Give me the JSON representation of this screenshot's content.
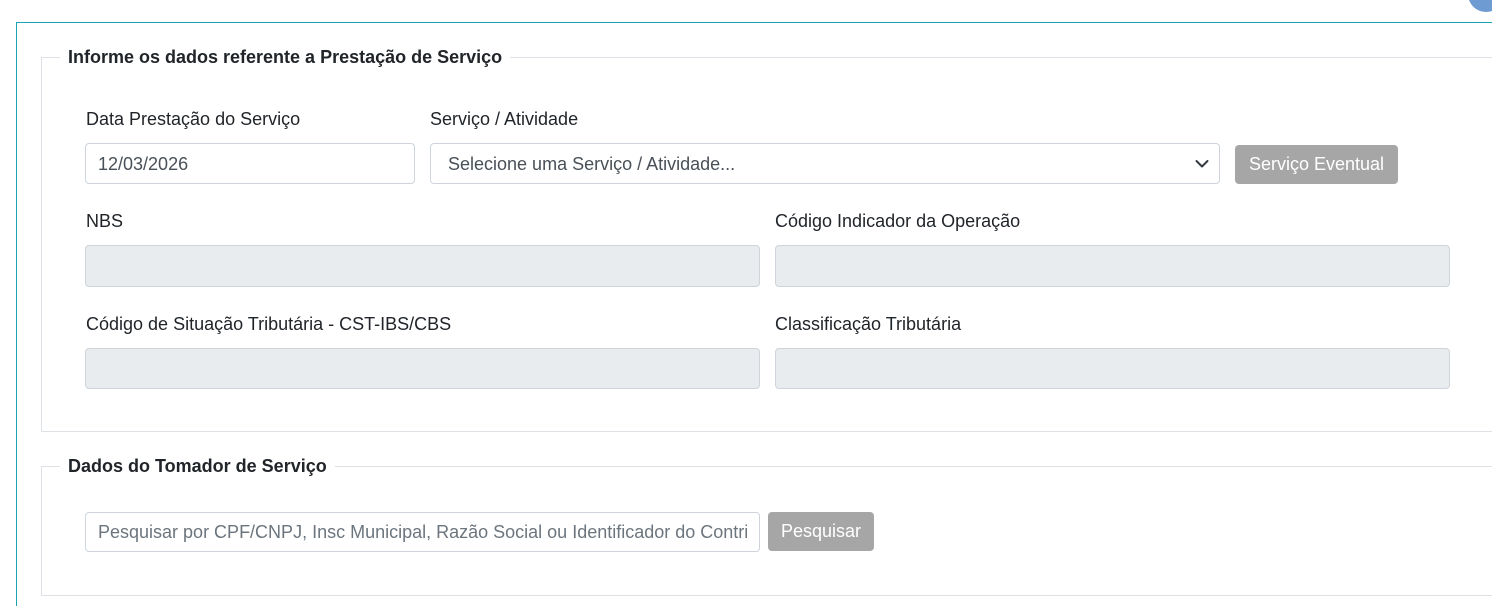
{
  "prestacao": {
    "legend": "Informe os dados referente a Prestação de Serviço",
    "data_label": "Data Prestação do Serviço",
    "data_value": "12/03/2026",
    "servico_label": "Serviço / Atividade",
    "servico_selected": "Selecione uma Serviço / Atividade...",
    "eventual_button": "Serviço Eventual",
    "nbs_label": "NBS",
    "nbs_value": "",
    "indicador_label": "Código Indicador da Operação",
    "indicador_value": "",
    "cst_label": "Código de Situação Tributária - CST-IBS/CBS",
    "cst_value": "",
    "classificacao_label": "Classificação Tributária",
    "classificacao_value": ""
  },
  "tomador": {
    "legend": "Dados do Tomador de Serviço",
    "search_placeholder": "Pesquisar por CPF/CNPJ, Insc Municipal, Razão Social ou Identificador do Contribuinte",
    "search_value": "",
    "search_button": "Pesquisar"
  },
  "colors": {
    "accent_border": "#1aa3b0",
    "button_gray": "#a6a6a6",
    "disabled_bg": "#e9ecef"
  }
}
